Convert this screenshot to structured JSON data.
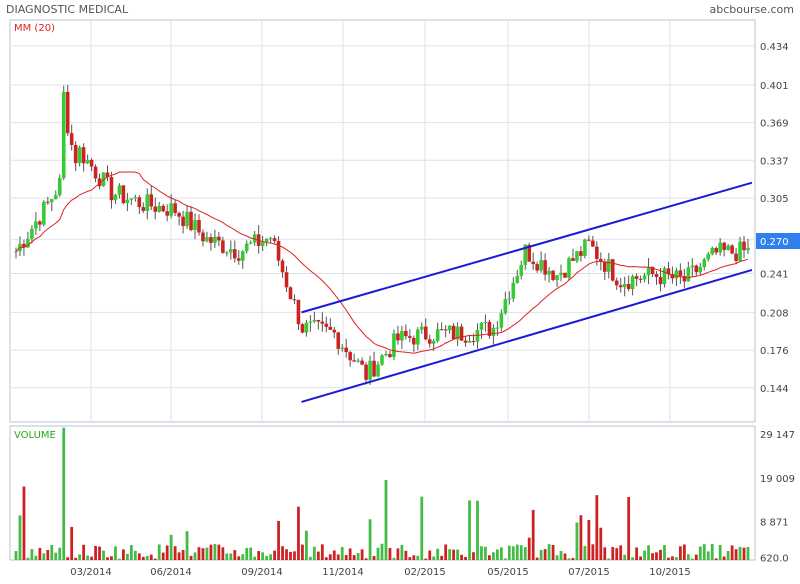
{
  "header": {
    "title": "DIAGNOSTIC MEDICAL",
    "source": "abcbourse.com"
  },
  "colors": {
    "up": "#33cc33",
    "down": "#cc2222",
    "ma": "#e02020",
    "channel": "#1a1ad6",
    "grid": "#dde2ea",
    "frame": "#b9c2cf",
    "last_bg": "#2f80ed",
    "volume": "#44bb44"
  },
  "chart_data": [
    {
      "type": "candlestick",
      "indicator_label": "MM (20)",
      "y_ticks": [
        0.434,
        0.401,
        0.369,
        0.337,
        0.305,
        0.27,
        0.241,
        0.208,
        0.176,
        0.144
      ],
      "ylim": [
        0.115,
        0.456
      ],
      "last_value": "0.270",
      "x_ticks": [
        "03/2014",
        "06/2014",
        "09/2014",
        "11/2014",
        "02/2015",
        "05/2015",
        "07/2015",
        "10/2015"
      ],
      "series_approx": [
        {
          "x": "01/2014",
          "close": 0.26
        },
        {
          "x": "02/2014",
          "close": 0.3
        },
        {
          "x": "03/2014",
          "close": 0.345
        },
        {
          "x": "04/2014",
          "close": 0.31
        },
        {
          "x": "05/2014",
          "close": 0.3
        },
        {
          "x": "06/2014",
          "close": 0.295
        },
        {
          "x": "07/2014",
          "close": 0.27
        },
        {
          "x": "08/2014",
          "close": 0.26
        },
        {
          "x": "09/2014",
          "close": 0.272
        },
        {
          "x": "10/2014",
          "close": 0.195
        },
        {
          "x": "11/2014",
          "close": 0.19
        },
        {
          "x": "12/2014",
          "close": 0.155
        },
        {
          "x": "01/2015",
          "close": 0.185
        },
        {
          "x": "02/2015",
          "close": 0.19
        },
        {
          "x": "03/2015",
          "close": 0.19
        },
        {
          "x": "04/2015",
          "close": 0.195
        },
        {
          "x": "05/2015",
          "close": 0.26
        },
        {
          "x": "06/2015",
          "close": 0.24
        },
        {
          "x": "07/2015",
          "close": 0.265
        },
        {
          "x": "08/2015",
          "close": 0.235
        },
        {
          "x": "09/2015",
          "close": 0.24
        },
        {
          "x": "10/2015",
          "close": 0.235
        },
        {
          "x": "11/2015",
          "close": 0.258
        },
        {
          "x": "12/2015",
          "close": 0.26
        }
      ],
      "channel_lines": [
        {
          "name": "upper",
          "from": {
            "x": "10/2014",
            "y": 0.208
          },
          "to": {
            "x": "12/2015",
            "y": 0.318
          }
        },
        {
          "name": "lower",
          "from": {
            "x": "10/2014",
            "y": 0.132
          },
          "to": {
            "x": "12/2015",
            "y": 0.244
          }
        }
      ]
    },
    {
      "type": "bar",
      "label": "VOLUME",
      "y_ticks": [
        "29 147",
        "19 009",
        "8 871",
        "620.0"
      ],
      "ylim": [
        0,
        31000
      ],
      "peak": 30600
    }
  ]
}
